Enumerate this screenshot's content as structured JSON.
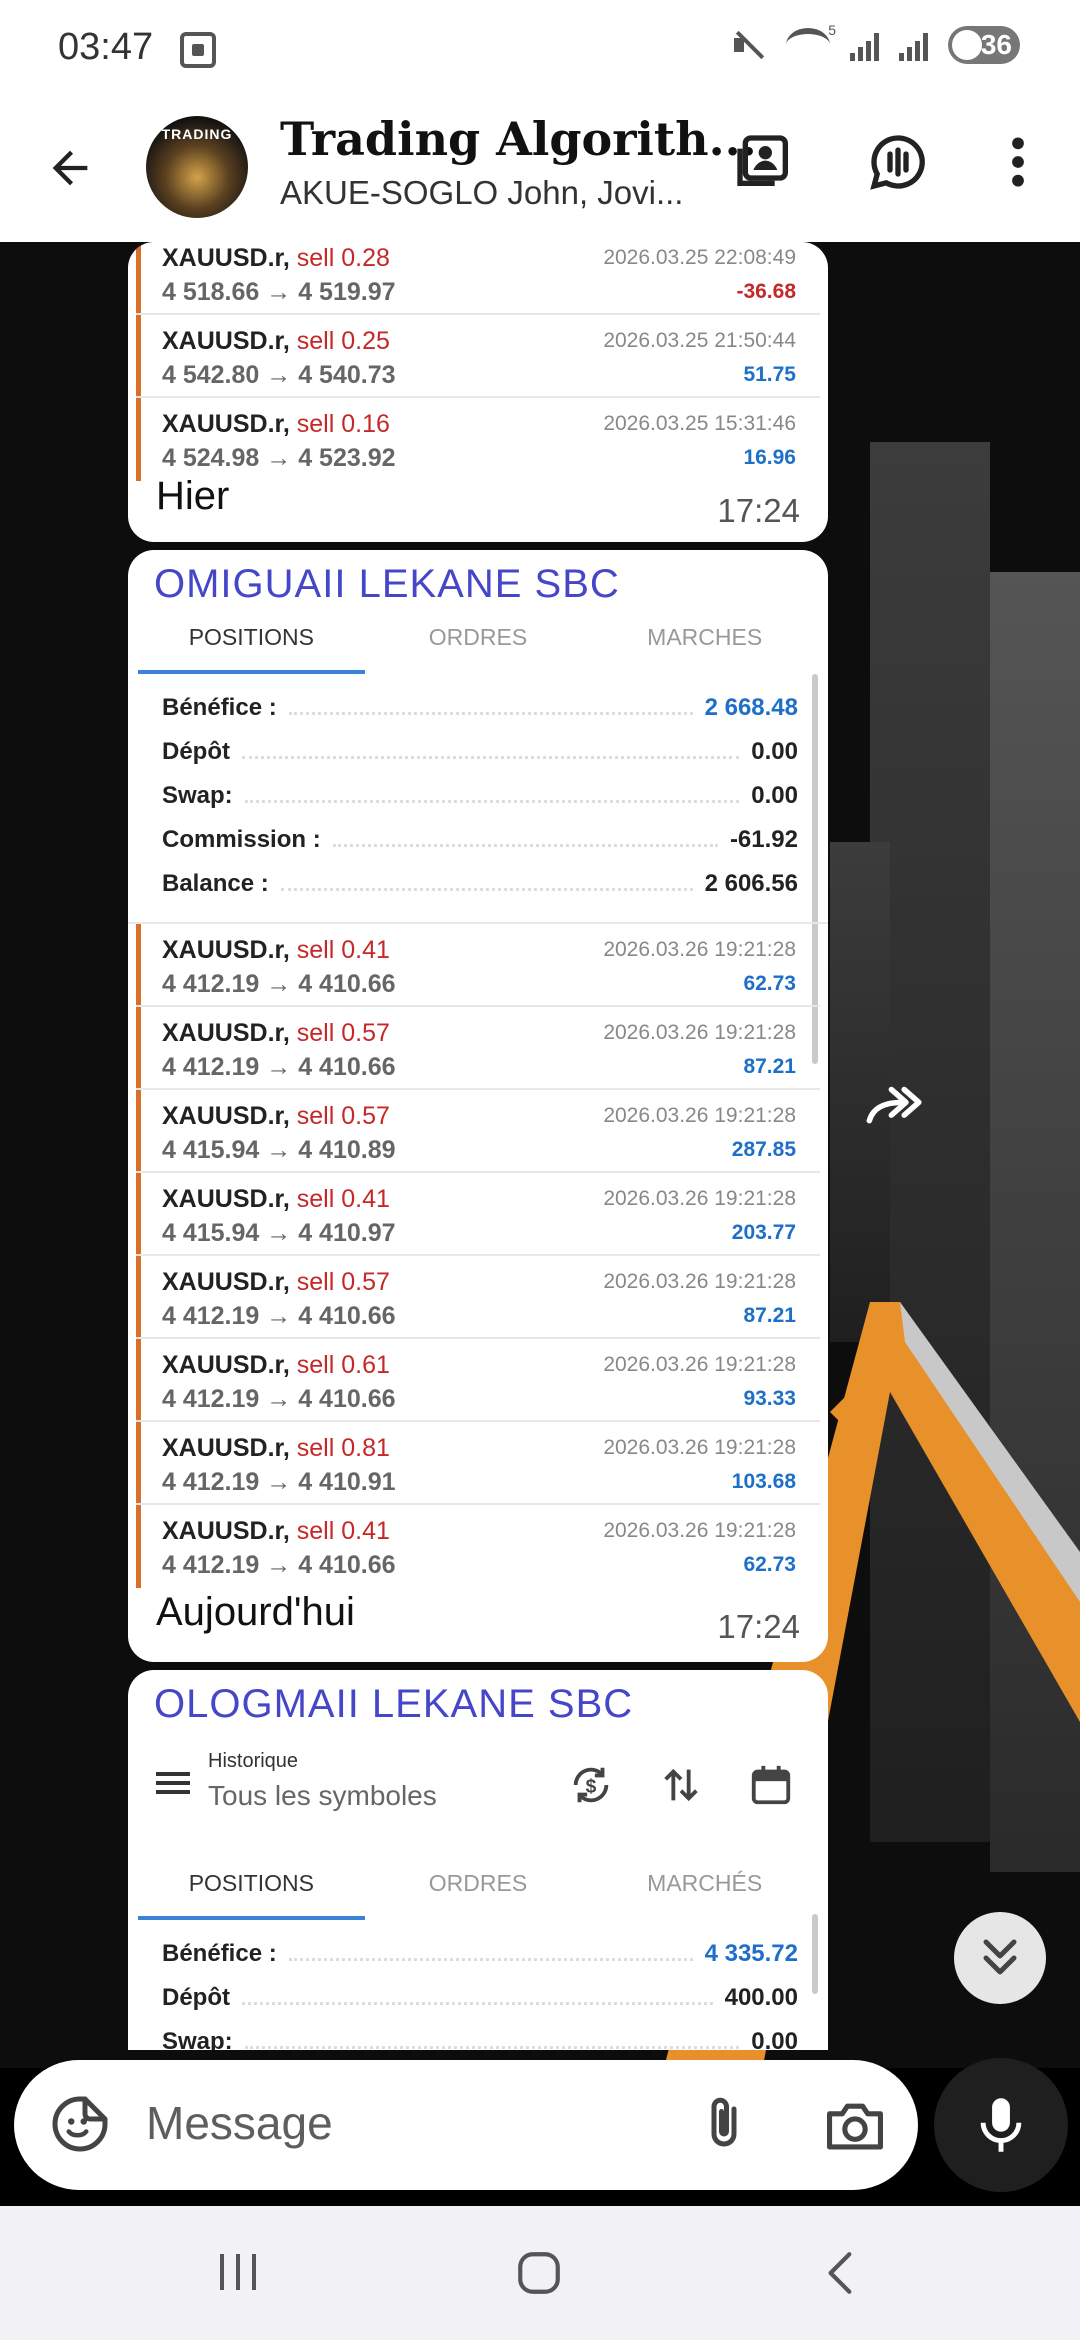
{
  "status_bar": {
    "time": "03:47",
    "battery": "36"
  },
  "app_bar": {
    "title": "Trading Algorith...",
    "subtitle": "AKUE-SOGLO John, Jovi...",
    "avatar_text": "TRADING"
  },
  "messages": [
    {
      "trades": [
        {
          "symbol": "XAUUSD.r,",
          "side": "sell 0.28",
          "prices": "4 518.66 → 4 519.97",
          "date": "2026.03.25 22:08:49",
          "profit": "-36.68",
          "negative": true
        },
        {
          "symbol": "XAUUSD.r,",
          "side": "sell 0.25",
          "prices": "4 542.80 → 4 540.73",
          "date": "2026.03.25 21:50:44",
          "profit": "51.75",
          "negative": false
        },
        {
          "symbol": "XAUUSD.r,",
          "side": "sell 0.16",
          "prices": "4 524.98 → 4 523.92",
          "date": "2026.03.25 15:31:46",
          "profit": "16.96",
          "negative": false
        }
      ],
      "caption": "Hier",
      "time": "17:24"
    },
    {
      "watermark": "OMIGUAII LEKANE  SBC",
      "tabs": [
        "POSITIONS",
        "ORDRES",
        "MARCHES"
      ],
      "summary": [
        {
          "label": "Bénéfice :",
          "value": "2 668.48",
          "blue": true
        },
        {
          "label": "Dépôt",
          "value": "0.00",
          "blue": false
        },
        {
          "label": "Swap:",
          "value": "0.00",
          "blue": false
        },
        {
          "label": "Commission :",
          "value": "-61.92",
          "blue": false
        },
        {
          "label": "Balance :",
          "value": "2 606.56",
          "blue": false
        }
      ],
      "trades": [
        {
          "symbol": "XAUUSD.r,",
          "side": "sell 0.41",
          "prices": "4 412.19 → 4 410.66",
          "date": "2026.03.26 19:21:28",
          "profit": "62.73",
          "negative": false
        },
        {
          "symbol": "XAUUSD.r,",
          "side": "sell 0.57",
          "prices": "4 412.19 → 4 410.66",
          "date": "2026.03.26 19:21:28",
          "profit": "87.21",
          "negative": false
        },
        {
          "symbol": "XAUUSD.r,",
          "side": "sell 0.57",
          "prices": "4 415.94 → 4 410.89",
          "date": "2026.03.26 19:21:28",
          "profit": "287.85",
          "negative": false
        },
        {
          "symbol": "XAUUSD.r,",
          "side": "sell 0.41",
          "prices": "4 415.94 → 4 410.97",
          "date": "2026.03.26 19:21:28",
          "profit": "203.77",
          "negative": false
        },
        {
          "symbol": "XAUUSD.r,",
          "side": "sell 0.57",
          "prices": "4 412.19 → 4 410.66",
          "date": "2026.03.26 19:21:28",
          "profit": "87.21",
          "negative": false
        },
        {
          "symbol": "XAUUSD.r,",
          "side": "sell 0.61",
          "prices": "4 412.19 → 4 410.66",
          "date": "2026.03.26 19:21:28",
          "profit": "93.33",
          "negative": false
        },
        {
          "symbol": "XAUUSD.r,",
          "side": "sell 0.81",
          "prices": "4 412.19 → 4 410.91",
          "date": "2026.03.26 19:21:28",
          "profit": "103.68",
          "negative": false
        },
        {
          "symbol": "XAUUSD.r,",
          "side": "sell 0.41",
          "prices": "4 412.19 → 4 410.66",
          "date": "2026.03.26 19:21:28",
          "profit": "62.73",
          "negative": false
        }
      ],
      "caption": "Aujourd'hui",
      "time": "17:24"
    },
    {
      "watermark": "OLOGMAII LEKANE  SBC",
      "history_title": "Historique",
      "history_subtitle": "Tous les symboles",
      "tabs": [
        "POSITIONS",
        "ORDRES",
        "MARCHÉS"
      ],
      "summary": [
        {
          "label": "Bénéfice :",
          "value": "4 335.72",
          "blue": true
        },
        {
          "label": "Dépôt",
          "value": "400.00",
          "blue": false
        },
        {
          "label": "Swap:",
          "value": "0.00",
          "blue": false
        }
      ]
    }
  ],
  "composer": {
    "placeholder": "Message"
  },
  "icons": {
    "back": "back-arrow-icon",
    "contact": "contact-card-icon",
    "voice_chat": "voice-chat-icon",
    "more": "more-vert-icon",
    "forward": "forward-icon",
    "scroll_down": "double-chevron-down-icon",
    "emoji": "sticker-icon",
    "attach": "paperclip-icon",
    "camera": "camera-icon",
    "mic": "microphone-icon"
  },
  "colors": {
    "sell": "#c62828",
    "profit": "#1e6fc8",
    "trade_accent": "#d9702a",
    "watermark": "#4646c8"
  }
}
